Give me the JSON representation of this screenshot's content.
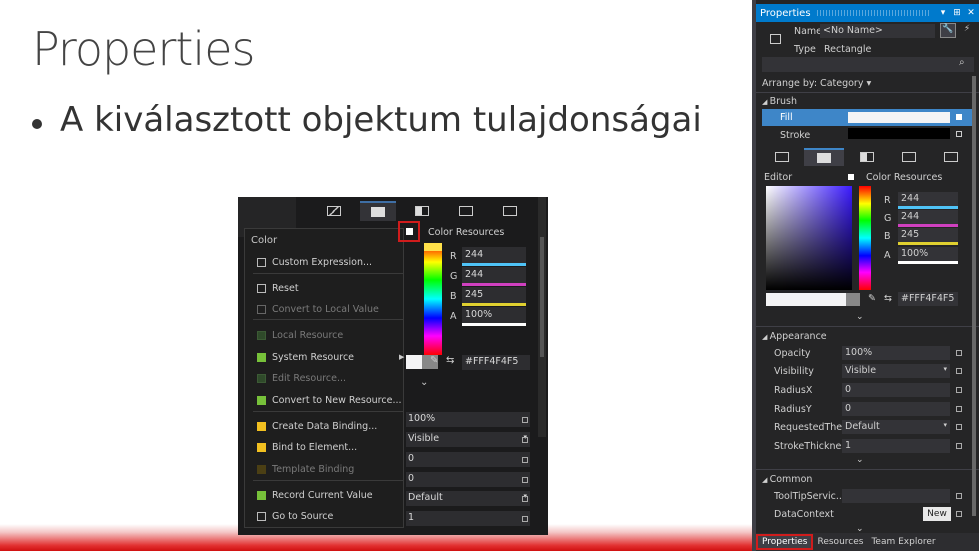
{
  "slide": {
    "title": "Properties",
    "bullet": "A kiválasztott objektum tulajdonságai"
  },
  "shot": {
    "context_menu": {
      "header": "Color",
      "items": [
        {
          "label": "Custom Expression...",
          "state": "normal",
          "swatch": "none"
        },
        {
          "label": "Reset",
          "state": "normal",
          "swatch": "none"
        },
        {
          "label": "Convert to Local Value",
          "state": "disabled",
          "swatch": "none"
        },
        {
          "label": "Local Resource",
          "state": "disabled",
          "swatch": "dark-green"
        },
        {
          "label": "System Resource",
          "state": "normal",
          "swatch": "green",
          "submenu": true
        },
        {
          "label": "Edit Resource...",
          "state": "disabled",
          "swatch": "dark-green"
        },
        {
          "label": "Convert to New Resource...",
          "state": "normal",
          "swatch": "green"
        },
        {
          "label": "Create Data Binding...",
          "state": "normal",
          "swatch": "yellow"
        },
        {
          "label": "Bind to Element...",
          "state": "normal",
          "swatch": "yellow"
        },
        {
          "label": "Template Binding",
          "state": "disabled",
          "swatch": "dark-yellow"
        },
        {
          "label": "Record Current Value",
          "state": "normal",
          "swatch": "green"
        },
        {
          "label": "Go to Source",
          "state": "normal",
          "swatch": "none"
        }
      ],
      "submenu_arrow": "▶"
    },
    "color_resources_label": "Color Resources",
    "channels": [
      {
        "label": "R",
        "value": "244",
        "color": "#4fc3f7"
      },
      {
        "label": "G",
        "value": "244",
        "color": "#d040c0"
      },
      {
        "label": "B",
        "value": "245",
        "color": "#e0d030"
      },
      {
        "label": "A",
        "value": "100%",
        "color": "#ffffff"
      }
    ],
    "hex_value": "#FFF4F4F5",
    "eyedropper": "✎",
    "swap": "⇆",
    "chevron": "⌄",
    "properties": [
      {
        "value": "100%",
        "dropdown": false
      },
      {
        "value": "Visible",
        "dropdown": true
      },
      {
        "value": "0",
        "dropdown": false
      },
      {
        "value": "0",
        "dropdown": false
      },
      {
        "value": "Default",
        "dropdown": true
      },
      {
        "value": "1",
        "dropdown": false
      }
    ],
    "dropdown_glyph": "▾"
  },
  "panel": {
    "title": "Properties",
    "title_icons": [
      "▾",
      "⊞",
      "✕"
    ],
    "name_label": "Name",
    "name_value": "<No Name>",
    "type_label": "Type",
    "type_value": "Rectangle",
    "wrench_glyph": "🔧",
    "bolt_glyph": "⚡",
    "search_glyph": "⌕",
    "arrange_by": "Arrange by: Category ▾",
    "brush": {
      "section": "Brush",
      "fill_label": "Fill",
      "stroke_label": "Stroke"
    },
    "editor_label": "Editor",
    "color_resources_label": "Color Resources",
    "channels": [
      {
        "label": "R",
        "value": "244",
        "color": "#4fc3f7"
      },
      {
        "label": "G",
        "value": "244",
        "color": "#d040c0"
      },
      {
        "label": "B",
        "value": "245",
        "color": "#e0d030"
      },
      {
        "label": "A",
        "value": "100%",
        "color": "#ffffff"
      }
    ],
    "hex_value": "#FFF4F4F5",
    "eyedropper": "✎",
    "swap": "⇆",
    "chevron": "⌄",
    "appearance": {
      "section": "Appearance",
      "rows": [
        {
          "label": "Opacity",
          "value": "100%",
          "dropdown": false
        },
        {
          "label": "Visibility",
          "value": "Visible",
          "dropdown": true
        },
        {
          "label": "RadiusX",
          "value": "0",
          "dropdown": false
        },
        {
          "label": "RadiusY",
          "value": "0",
          "dropdown": false
        },
        {
          "label": "RequestedThe...",
          "value": "Default",
          "dropdown": true
        },
        {
          "label": "StrokeThickness",
          "value": "1",
          "dropdown": false
        }
      ]
    },
    "common": {
      "section": "Common",
      "rows": [
        {
          "label": "ToolTipServic...",
          "value": ""
        },
        {
          "label": "DataContext",
          "value": ""
        }
      ],
      "new_button": "New"
    },
    "dropdown_glyph": "▾",
    "bottom_tabs": [
      "Properties",
      "Resources",
      "Team Explorer"
    ]
  }
}
